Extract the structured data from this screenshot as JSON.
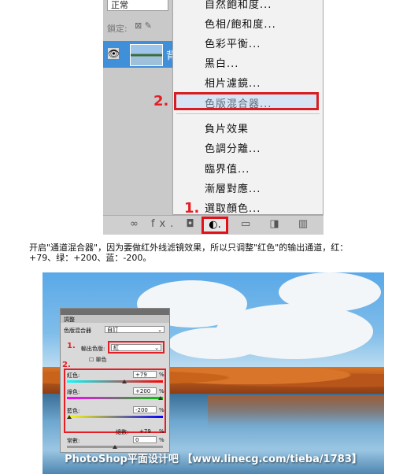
{
  "top_screenshot": {
    "blend_mode": "正常",
    "lock_label": "鎖定:",
    "layer_name": "背",
    "menu_items": [
      "自然飽和度...",
      "色相/飽和度...",
      "色彩平衡...",
      "黑白...",
      "相片濾鏡...",
      "色版混合器...",
      "負片效果",
      "色調分離...",
      "臨界值...",
      "漸層對應...",
      "選取顏色..."
    ],
    "step1": "1.",
    "step2": "2.",
    "bottom_icons": "∞ fx. ◘",
    "adjust_icon": "◐.",
    "right_icons": "▭ ◨ ▥"
  },
  "caption": {
    "line1": "开启\"通道混合器\"，因为要做红外线滤镜效果，所以只调整\"红色\"的输出通道，红：",
    "line2": "+79、绿：+200、蓝：-200。"
  },
  "mixer_panel": {
    "header": "調整",
    "title_label": "色版混合器",
    "preset": "自訂",
    "step1": "1.",
    "output_label": "輸出色版:",
    "output_value": "紅",
    "mono_label": "單色",
    "step2": "2.",
    "red_label": "紅色:",
    "red_value": "+79",
    "green_label": "綠色:",
    "green_value": "+200",
    "blue_label": "藍色:",
    "blue_value": "-200",
    "pct": "%",
    "total_label": "總數:",
    "total_value": "+79",
    "constant_label": "常數:",
    "constant_value": "0"
  },
  "sliders": {
    "red": 0.6,
    "green": 1.0,
    "blue": 0.0,
    "constant": 0.5
  },
  "watermark": "PhotoShop平面设计吧 【www.linecg.com/tieba/1783】",
  "colors": {
    "accent_red": "#e31e24",
    "layer_blue": "#3f8fd9"
  }
}
